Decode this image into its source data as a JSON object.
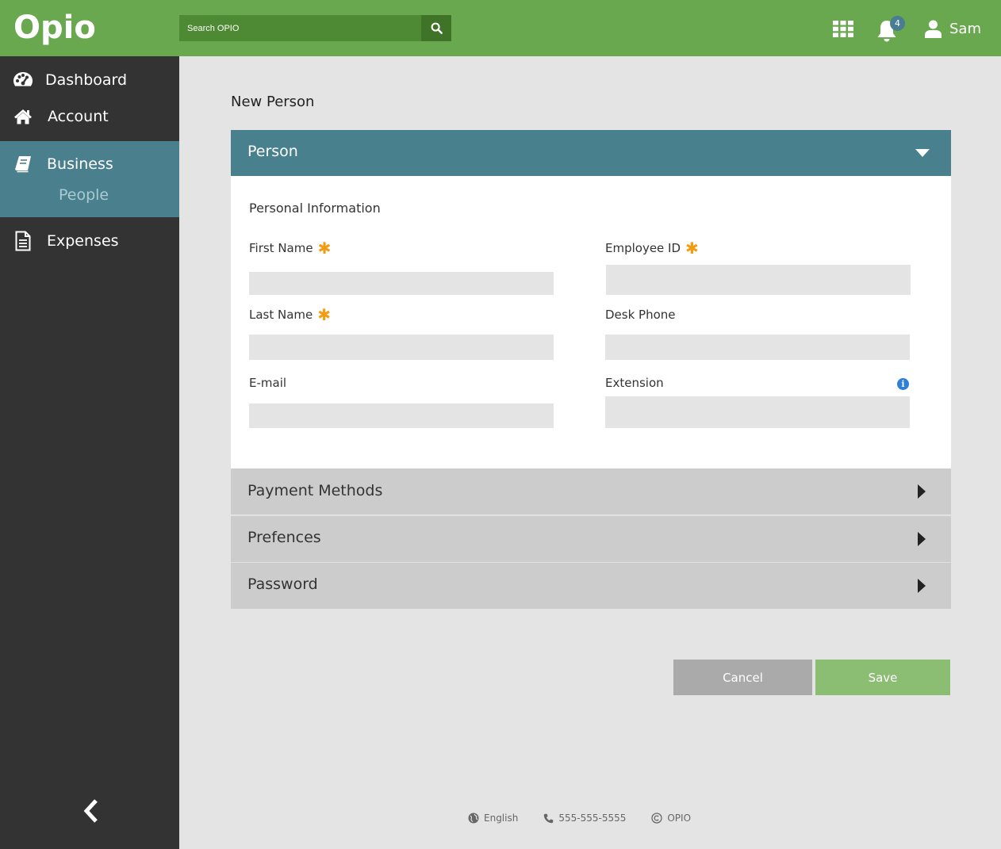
{
  "app": {
    "logo": "Opio"
  },
  "header": {
    "search_placeholder": "Search OPIO",
    "notification_count": "4",
    "user_name": "Sam"
  },
  "sidebar": {
    "items": [
      {
        "label": "Dashboard",
        "icon": "palette-icon"
      },
      {
        "label": "Account",
        "icon": "home-icon"
      },
      {
        "label": "Business",
        "icon": "book-icon",
        "active": true
      },
      {
        "label": "Expenses",
        "icon": "document-icon"
      }
    ],
    "sub_item": "People"
  },
  "main": {
    "page_title": "New Person",
    "panel": {
      "title": "Person",
      "section_title": "Personal Information",
      "fields": {
        "first_name": {
          "label": "First Name",
          "required": true,
          "value": ""
        },
        "last_name": {
          "label": "Last Name",
          "required": true,
          "value": ""
        },
        "email": {
          "label": "E-mail",
          "required": false,
          "value": ""
        },
        "employee_id": {
          "label": "Employee ID",
          "required": true,
          "value": ""
        },
        "desk_phone": {
          "label": "Desk Phone",
          "required": false,
          "value": ""
        },
        "extension": {
          "label": "Extension",
          "required": false,
          "value": ""
        }
      },
      "required_mark": "✱",
      "info_mark": "i"
    },
    "sections": [
      "Payment Methods",
      "Prefences",
      "Password"
    ],
    "buttons": {
      "cancel": "Cancel",
      "save": "Save"
    }
  },
  "footer": {
    "language": "English",
    "phone": "555-555-5555",
    "brand": "OPIO"
  },
  "colors": {
    "header_green": "#69a84f",
    "sidebar_dark": "#333333",
    "active_teal": "#4a7f8e",
    "panel_head": "#48808e",
    "required_orange": "#f39c12",
    "save_green": "#8bbd73",
    "cancel_gray": "#aaaaaa"
  }
}
